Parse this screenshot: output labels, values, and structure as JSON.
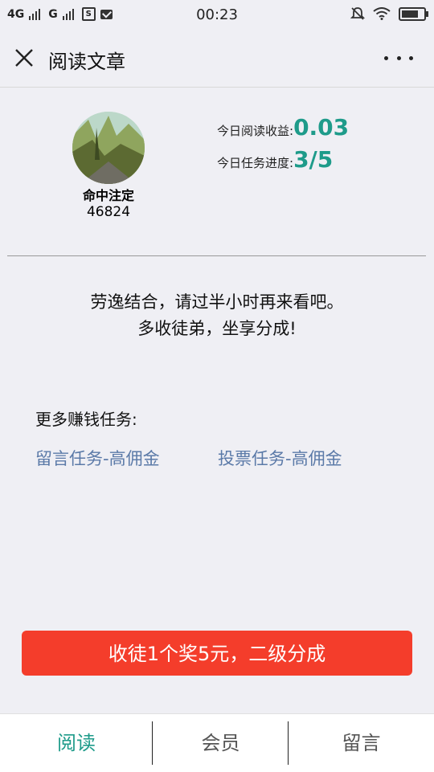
{
  "status_bar": {
    "signal1": "4G",
    "signal2": "G",
    "sim_icon": "S",
    "time": "00:23"
  },
  "header": {
    "title": "阅读文章"
  },
  "profile": {
    "name": "命中注定",
    "id": "46824"
  },
  "stats": {
    "income_label": "今日阅读收益:",
    "income_value": "0.03",
    "progress_label": "今日任务进度:",
    "progress_value": "3/5"
  },
  "message": {
    "line1": "劳逸结合，请过半小时再来看吧。",
    "line2": "多收徒弟，坐享分成!"
  },
  "more_tasks": {
    "label": "更多赚钱任务:",
    "links": [
      "留言任务-高佣金",
      "投票任务-高佣金"
    ]
  },
  "cta": {
    "label": "收徒1个奖5元，二级分成"
  },
  "tabs": [
    {
      "label": "阅读",
      "active": true
    },
    {
      "label": "会员",
      "active": false
    },
    {
      "label": "留言",
      "active": false
    }
  ],
  "colors": {
    "accent": "#1e9b8a",
    "cta": "#f43d2b",
    "link": "#5b7aa8"
  }
}
